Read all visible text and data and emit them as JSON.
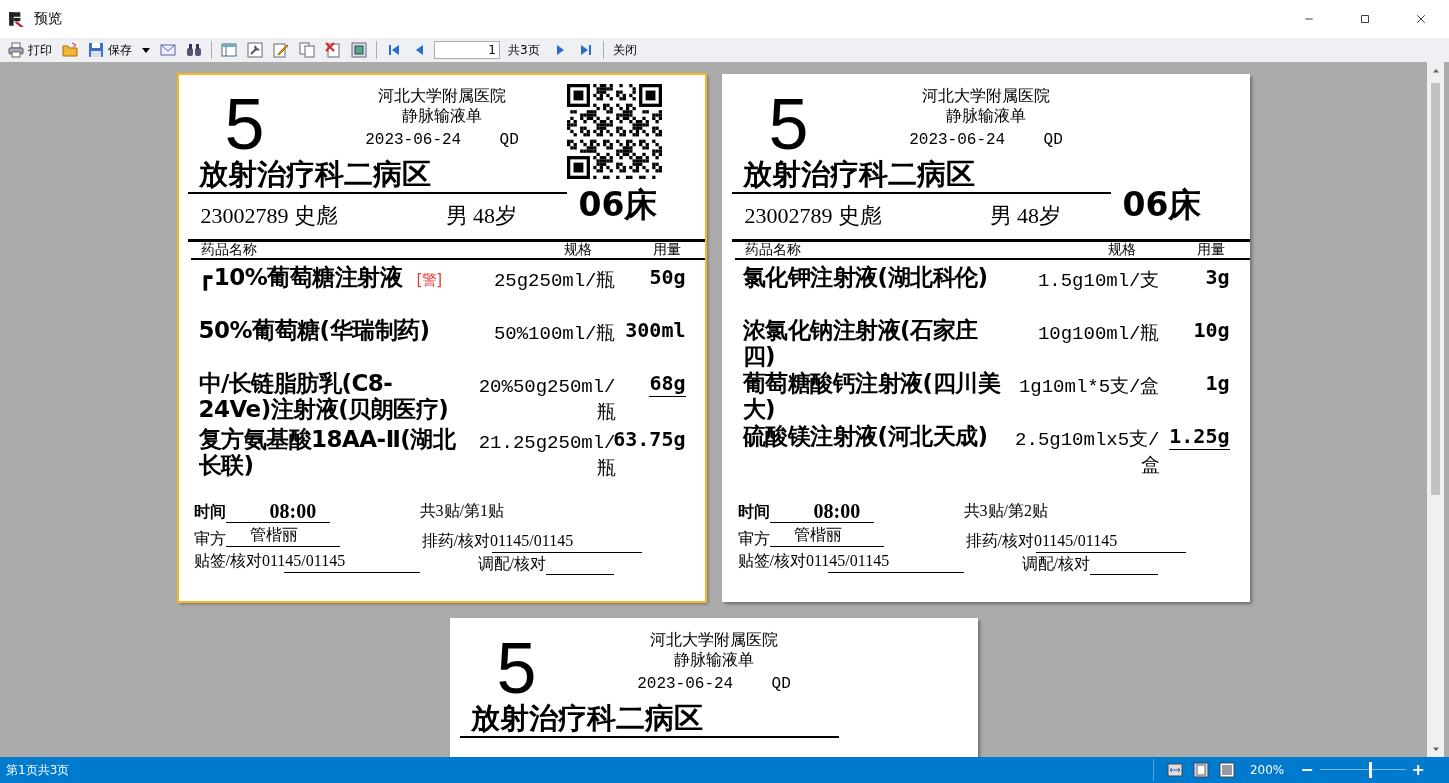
{
  "window": {
    "title": "预览"
  },
  "toolbar": [
    {
      "kind": "print",
      "label": "打印"
    },
    {
      "kind": "open"
    },
    {
      "kind": "save",
      "label": "保存"
    },
    {
      "kind": "menu"
    },
    {
      "kind": "email"
    },
    {
      "kind": "find"
    },
    {
      "kind": "separator"
    },
    {
      "kind": "outline"
    },
    {
      "kind": "setup"
    },
    {
      "kind": "edit"
    },
    {
      "kind": "copy"
    },
    {
      "kind": "delete"
    },
    {
      "kind": "frame"
    },
    {
      "kind": "separator"
    },
    {
      "kind": "first"
    },
    {
      "kind": "prev"
    },
    {
      "kind": "page_field",
      "value": "1"
    },
    {
      "kind": "text",
      "label": "共3页"
    },
    {
      "kind": "next"
    },
    {
      "kind": "last"
    },
    {
      "kind": "separator"
    },
    {
      "kind": "close",
      "label": "关闭"
    }
  ],
  "labels": [
    {
      "selected": true,
      "qr_code": true,
      "number": "5",
      "hospital": "河北大学附属医院",
      "form_title": "静脉输液单",
      "date": "2023-06-24",
      "frequency": "QD",
      "ward": "放射治疗科二病区",
      "patient_id": "23002789",
      "patient_name": "史彪",
      "sex": "男",
      "age": "48岁",
      "bed": "06床",
      "columns": [
        "药品名称",
        "规格",
        "用量"
      ],
      "drugs": [
        {
          "marker": "┏",
          "name": "10%葡萄糖注射液",
          "warning": "[警]",
          "spec": "25g250ml/瓶",
          "dose": "50g",
          "underlined": false
        },
        {
          "name": "50%葡萄糖(华瑞制药)",
          "spec": "50%100ml/瓶",
          "dose": "300ml",
          "underlined": false
        },
        {
          "name": "中/长链脂肪乳(C8-24Ve)注射液(贝朗医疗)",
          "spec": "20%50g250ml/瓶",
          "dose": "68g",
          "underlined": true
        },
        {
          "name": "复方氨基酸18AA-Ⅱ(湖北长联)",
          "spec": "21.25g250ml/瓶",
          "dose": "63.75g",
          "underlined": false
        }
      ],
      "footer": {
        "time_label": "时间",
        "time": "08:00",
        "count": "共3贴/第1贴",
        "review_label": "审方",
        "reviewer": "管楷丽",
        "dispense": "排药/核对01145/01145",
        "label_check": "贴签/核对01145/01145",
        "mix_label": "调配/核对"
      }
    },
    {
      "selected": false,
      "qr_code": false,
      "number": "5",
      "hospital": "河北大学附属医院",
      "form_title": "静脉输液单",
      "date": "2023-06-24",
      "frequency": "QD",
      "ward": "放射治疗科二病区",
      "patient_id": "23002789",
      "patient_name": "史彪",
      "sex": "男",
      "age": "48岁",
      "bed": "06床",
      "columns": [
        "药品名称",
        "规格",
        "用量"
      ],
      "drugs": [
        {
          "name": "氯化钾注射液(湖北科伦)",
          "spec": "1.5g10ml/支",
          "dose": "3g",
          "underlined": false
        },
        {
          "name": "浓氯化钠注射液(石家庄四)",
          "spec": "10g100ml/瓶",
          "dose": "10g",
          "underlined": false
        },
        {
          "name": "葡萄糖酸钙注射液(四川美大)",
          "spec": "1g10ml*5支/盒",
          "dose": "1g",
          "underlined": false
        },
        {
          "name": "硫酸镁注射液(河北天成)",
          "spec": "2.5g10mlx5支/盒",
          "dose": "1.25g",
          "underlined": true
        }
      ],
      "footer": {
        "time_label": "时间",
        "time": "08:00",
        "count": "共3贴/第2贴",
        "review_label": "审方",
        "reviewer": "管楷丽",
        "dispense": "排药/核对01145/01145",
        "label_check": "贴签/核对01145/01145",
        "mix_label": "调配/核对"
      }
    },
    {
      "selected": false,
      "qr_code": false,
      "number": "5",
      "hospital": "河北大学附属医院",
      "form_title": "静脉输液单",
      "date": "2023-06-24",
      "frequency": "QD",
      "ward": "放射治疗科二病区"
    }
  ],
  "status_bar": {
    "page_info": "第1页共3页",
    "zoom": "200%",
    "zoom_out": "−",
    "zoom_in": "+",
    "level": 0.59
  }
}
